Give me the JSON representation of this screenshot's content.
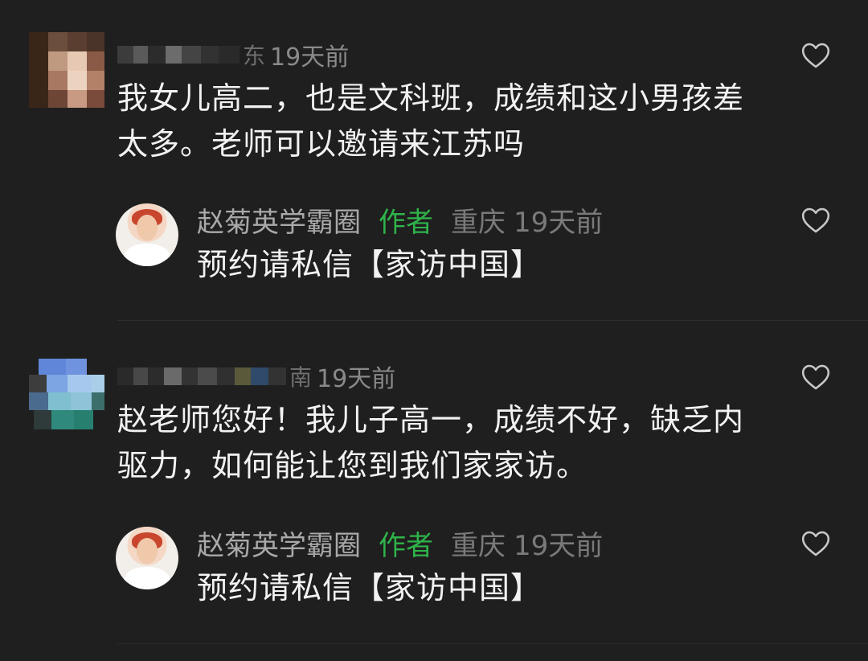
{
  "comments": [
    {
      "time": "19天前",
      "name_partial": "东",
      "text_line1": "我女儿高二，也是文科班，成绩和这小男孩差",
      "text_line2": "太多。老师可以邀请来江苏吗",
      "reply": {
        "name": "赵菊英学霸圈",
        "tag": "作者",
        "location": "重庆",
        "time": "19天前",
        "text": "预约请私信【家访中国】"
      }
    },
    {
      "time": "19天前",
      "name_partial": "南",
      "text_line1": "赵老师您好！我儿子高一，成绩不好，缺乏内",
      "text_line2": "驱力，如何能让您到我们家家访。",
      "reply": {
        "name": "赵菊英学霸圈",
        "tag": "作者",
        "location": "重庆",
        "time": "19天前",
        "text": "预约请私信【家访中国】"
      }
    }
  ],
  "icons": {
    "like": "heart-outline-icon"
  },
  "colors": {
    "background": "#1f1f1f",
    "author_tag": "#2fb34a",
    "meta": "#8a8a8a"
  }
}
